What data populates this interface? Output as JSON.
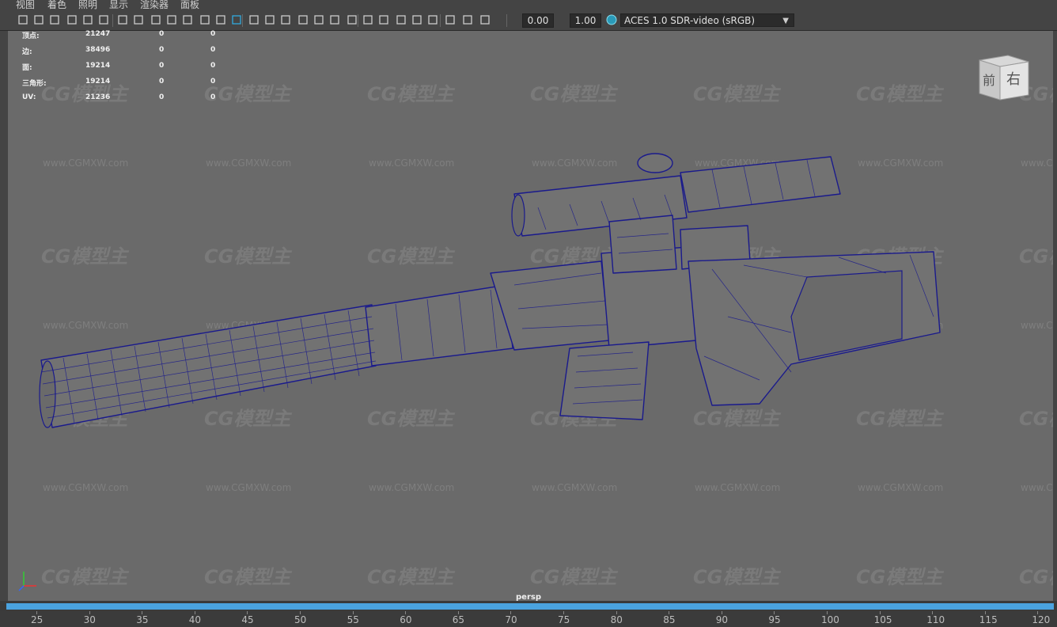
{
  "menu": [
    "视图",
    "着色",
    "照明",
    "显示",
    "渲染器",
    "面板"
  ],
  "toolbar": {
    "exposure_value": "0.00",
    "gamma_value": "1.00",
    "color_management": "ACES 1.0 SDR-video (sRGB)"
  },
  "hud": {
    "rows": [
      {
        "label": "顶点:",
        "v1": "21247",
        "v2": "0",
        "v3": "0"
      },
      {
        "label": "边:",
        "v1": "38496",
        "v2": "0",
        "v3": "0"
      },
      {
        "label": "面:",
        "v1": "19214",
        "v2": "0",
        "v3": "0"
      },
      {
        "label": "三角形:",
        "v1": "19214",
        "v2": "0",
        "v3": "0"
      },
      {
        "label": "UV:",
        "v1": "21236",
        "v2": "0",
        "v3": "0"
      }
    ]
  },
  "viewcube": {
    "front": "前",
    "right": "右"
  },
  "camera_label": "persp",
  "watermark": {
    "logo": "CG模型主",
    "url": "www.CGMXW.com"
  },
  "timeline": {
    "ticks": [
      "25",
      "30",
      "35",
      "40",
      "45",
      "50",
      "55",
      "60",
      "65",
      "70",
      "75",
      "80",
      "85",
      "90",
      "95",
      "100",
      "105",
      "110",
      "115",
      "120"
    ]
  },
  "colors": {
    "viewport_bg": "#6a6a6a",
    "wireframe": "#1a1a8c",
    "timeline_bar": "#4aa3df"
  }
}
